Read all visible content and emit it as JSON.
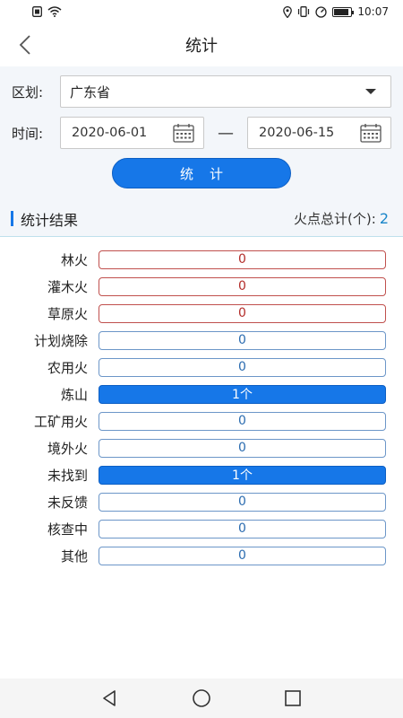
{
  "status_bar": {
    "time": "10:07",
    "left_icons": [
      "sim-card-icon",
      "wifi-icon"
    ],
    "right_icons": [
      "location-icon",
      "vibrate-icon",
      "data-saver-icon",
      "battery-icon"
    ]
  },
  "header": {
    "title": "统计",
    "back_icon": "chevron-left-icon"
  },
  "form": {
    "region_label": "区划:",
    "region_value": "广东省",
    "time_label": "时间:",
    "start_date": "2020-06-01",
    "separator": "—",
    "end_date": "2020-06-15",
    "submit_label": "统计"
  },
  "results": {
    "title": "统计结果",
    "total_label": "火点总计(个):",
    "total_value": "2",
    "rows": [
      {
        "label": "林火",
        "value": "0",
        "style": "red"
      },
      {
        "label": "灌木火",
        "value": "0",
        "style": "red"
      },
      {
        "label": "草原火",
        "value": "0",
        "style": "red"
      },
      {
        "label": "计划烧除",
        "value": "0",
        "style": "blue"
      },
      {
        "label": "农用火",
        "value": "0",
        "style": "blue"
      },
      {
        "label": "炼山",
        "value": "1个",
        "style": "filled"
      },
      {
        "label": "工矿用火",
        "value": "0",
        "style": "blue"
      },
      {
        "label": "境外火",
        "value": "0",
        "style": "blue"
      },
      {
        "label": "未找到",
        "value": "1个",
        "style": "filled"
      },
      {
        "label": "未反馈",
        "value": "0",
        "style": "blue"
      },
      {
        "label": "核查中",
        "value": "0",
        "style": "blue"
      },
      {
        "label": "其他",
        "value": "0",
        "style": "blue"
      }
    ]
  },
  "colors": {
    "accent": "#1677e8",
    "red_border": "#c0504d",
    "blue_border": "#6c96c8",
    "total_count": "#1a86c9"
  },
  "nav_bar": {
    "icons": [
      "back-triangle-icon",
      "home-circle-icon",
      "recents-square-icon"
    ]
  }
}
